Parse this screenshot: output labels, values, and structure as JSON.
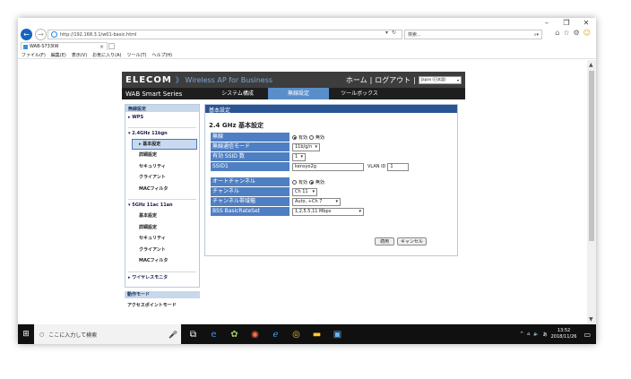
{
  "browser": {
    "url": "http://192.168.3.1/w01-basic.html",
    "search_placeholder": "検索...",
    "tab_title": "WAB-S733IW",
    "menu": [
      "ファイル(F)",
      "編集(E)",
      "表示(V)",
      "お気に入り(A)",
      "ツール(T)",
      "ヘルプ(H)"
    ]
  },
  "router": {
    "logo": "ELECOM",
    "subtitle": "》 Wireless AP for Business",
    "home": "ホーム",
    "logout": "ログアウト",
    "language": "Japan (日本語)",
    "product": "WAB Smart Series",
    "nav": [
      "システム構成",
      "無線設定",
      "ツールボックス"
    ],
    "sidebar": {
      "header": "無線設定",
      "wps": "WPS",
      "band24": "2.4GHz 11bgn",
      "band24_items": [
        "基本設定",
        "詳細設定",
        "セキュリティ",
        "クライアント",
        "MACフィルタ"
      ],
      "band5": "5GHz 11ac 11an",
      "band5_items": [
        "基本設定",
        "詳細設定",
        "セキュリティ",
        "クライアント",
        "MACフィルタ"
      ],
      "monitor": "ワイヤレスモニタ",
      "mode_header": "動作モード",
      "mode_value": "アクセスポイントモード"
    },
    "content": {
      "header": "基本設定",
      "title": "2.4 GHz 基本設定",
      "labels": {
        "wireless": "無線",
        "mode": "無線通信モード",
        "ssid_count": "有効 SSID 数",
        "ssid1": "SSID1",
        "auto_channel": "オートチャンネル",
        "channel": "チャンネル",
        "bandwidth": "チャンネル帯域幅",
        "bss_rate": "BSS BasicRateSet"
      },
      "values": {
        "enable": "有効",
        "disable": "無効",
        "mode": "11b/g/n",
        "ssid_count": "1",
        "ssid1": "kensyo2g",
        "vlan_label": "VLAN ID",
        "vlan_id": "1",
        "channel": "Ch 11",
        "bandwidth": "Auto, +Ch 7",
        "bss_rate": "1,2,5.5,11 Mbps"
      },
      "apply": "適用",
      "cancel": "キャンセル"
    }
  },
  "taskbar": {
    "search": "ここに入力して検索",
    "time": "13:52",
    "date": "2018/11/26"
  }
}
